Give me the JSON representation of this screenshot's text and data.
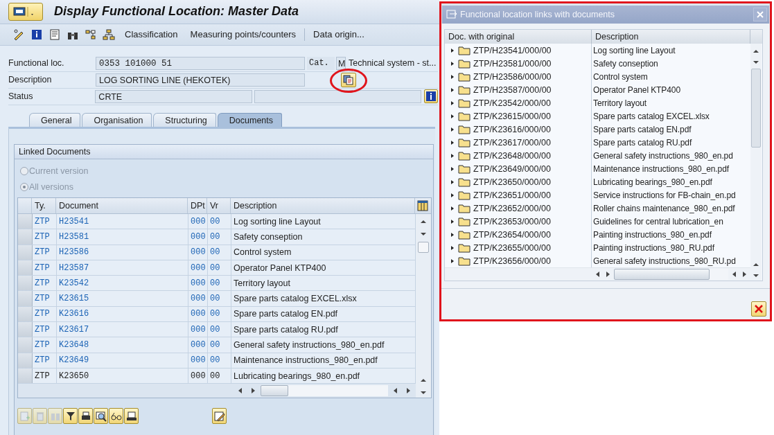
{
  "window": {
    "title": "Display Functional Location: Master Data"
  },
  "toolbar": {
    "buttons": [
      "Classification",
      "Measuring points/counters",
      "Data origin..."
    ]
  },
  "header": {
    "functional_loc": {
      "label": "Functional loc.",
      "value": "0353 101000 51"
    },
    "category": {
      "label": "Cat.",
      "value": "M",
      "text": "Technical system - st..."
    },
    "description": {
      "label": "Description",
      "value": "LOG SORTING LINE (HEKOTEK)"
    },
    "status": {
      "label": "Status",
      "value": "CRTE"
    }
  },
  "tabs": [
    {
      "label": "General",
      "selected": false
    },
    {
      "label": "Organisation",
      "selected": false
    },
    {
      "label": "Structuring",
      "selected": false
    },
    {
      "label": "Documents",
      "selected": true
    }
  ],
  "linked_documents": {
    "title": "Linked Documents",
    "versions": [
      {
        "label": "Current version",
        "selected": false,
        "disabled": true
      },
      {
        "label": "All versions",
        "selected": true,
        "disabled": true
      }
    ],
    "columns": [
      "Ty.",
      "Document",
      "DPt",
      "Vr",
      "Description"
    ],
    "rows": [
      {
        "type": "ZTP",
        "document": "H23541",
        "part": "000",
        "version": "00",
        "description": "Log sorting line Layout",
        "linked": true
      },
      {
        "type": "ZTP",
        "document": "H23581",
        "part": "000",
        "version": "00",
        "description": "Safety conseption",
        "linked": true
      },
      {
        "type": "ZTP",
        "document": "H23586",
        "part": "000",
        "version": "00",
        "description": "Control system",
        "linked": true
      },
      {
        "type": "ZTP",
        "document": "H23587",
        "part": "000",
        "version": "00",
        "description": "Operator Panel KTP400",
        "linked": true
      },
      {
        "type": "ZTP",
        "document": "K23542",
        "part": "000",
        "version": "00",
        "description": "Territory layout",
        "linked": true
      },
      {
        "type": "ZTP",
        "document": "K23615",
        "part": "000",
        "version": "00",
        "description": "Spare parts catalog EXCEL.xlsx",
        "linked": true
      },
      {
        "type": "ZTP",
        "document": "K23616",
        "part": "000",
        "version": "00",
        "description": "Spare parts catalog EN.pdf",
        "linked": true
      },
      {
        "type": "ZTP",
        "document": "K23617",
        "part": "000",
        "version": "00",
        "description": "Spare parts catalog RU.pdf",
        "linked": true
      },
      {
        "type": "ZTP",
        "document": "K23648",
        "part": "000",
        "version": "00",
        "description": "General safety instructions_980_en.pdf",
        "linked": true
      },
      {
        "type": "ZTP",
        "document": "K23649",
        "part": "000",
        "version": "00",
        "description": "Maintenance instructions_980_en.pdf",
        "linked": true
      },
      {
        "type": "ZTP",
        "document": "K23650",
        "part": "000",
        "version": "00",
        "description": "Lubricating bearings_980_en.pdf",
        "linked": false
      }
    ]
  },
  "popup": {
    "title": "Functional location links with documents",
    "columns": [
      "Doc. with original",
      "Description"
    ],
    "rows": [
      {
        "document": "ZTP/H23541/000/00",
        "description": "Log sorting line Layout"
      },
      {
        "document": "ZTP/H23581/000/00",
        "description": "Safety conseption"
      },
      {
        "document": "ZTP/H23586/000/00",
        "description": "Control system"
      },
      {
        "document": "ZTP/H23587/000/00",
        "description": "Operator Panel KTP400"
      },
      {
        "document": "ZTP/K23542/000/00",
        "description": "Territory layout"
      },
      {
        "document": "ZTP/K23615/000/00",
        "description": "Spare parts catalog EXCEL.xlsx"
      },
      {
        "document": "ZTP/K23616/000/00",
        "description": "Spare parts catalog EN.pdf"
      },
      {
        "document": "ZTP/K23617/000/00",
        "description": "Spare parts catalog RU.pdf"
      },
      {
        "document": "ZTP/K23648/000/00",
        "description": "General safety instructions_980_en.pd"
      },
      {
        "document": "ZTP/K23649/000/00",
        "description": "Maintenance instructions_980_en.pdf"
      },
      {
        "document": "ZTP/K23650/000/00",
        "description": "Lubricating bearings_980_en.pdf"
      },
      {
        "document": "ZTP/K23651/000/00",
        "description": "Service instructions for FB-chain_en.pd"
      },
      {
        "document": "ZTP/K23652/000/00",
        "description": "Roller chains maintenance_980_en.pdf"
      },
      {
        "document": "ZTP/K23653/000/00",
        "description": "Guidelines for central lubrication_en"
      },
      {
        "document": "ZTP/K23654/000/00",
        "description": "Painting instructions_980_en.pdf"
      },
      {
        "document": "ZTP/K23655/000/00",
        "description": "Painting instructions_980_RU.pdf"
      },
      {
        "document": "ZTP/K23656/000/00",
        "description": "General safety instructions_980_RU.pd"
      }
    ]
  }
}
